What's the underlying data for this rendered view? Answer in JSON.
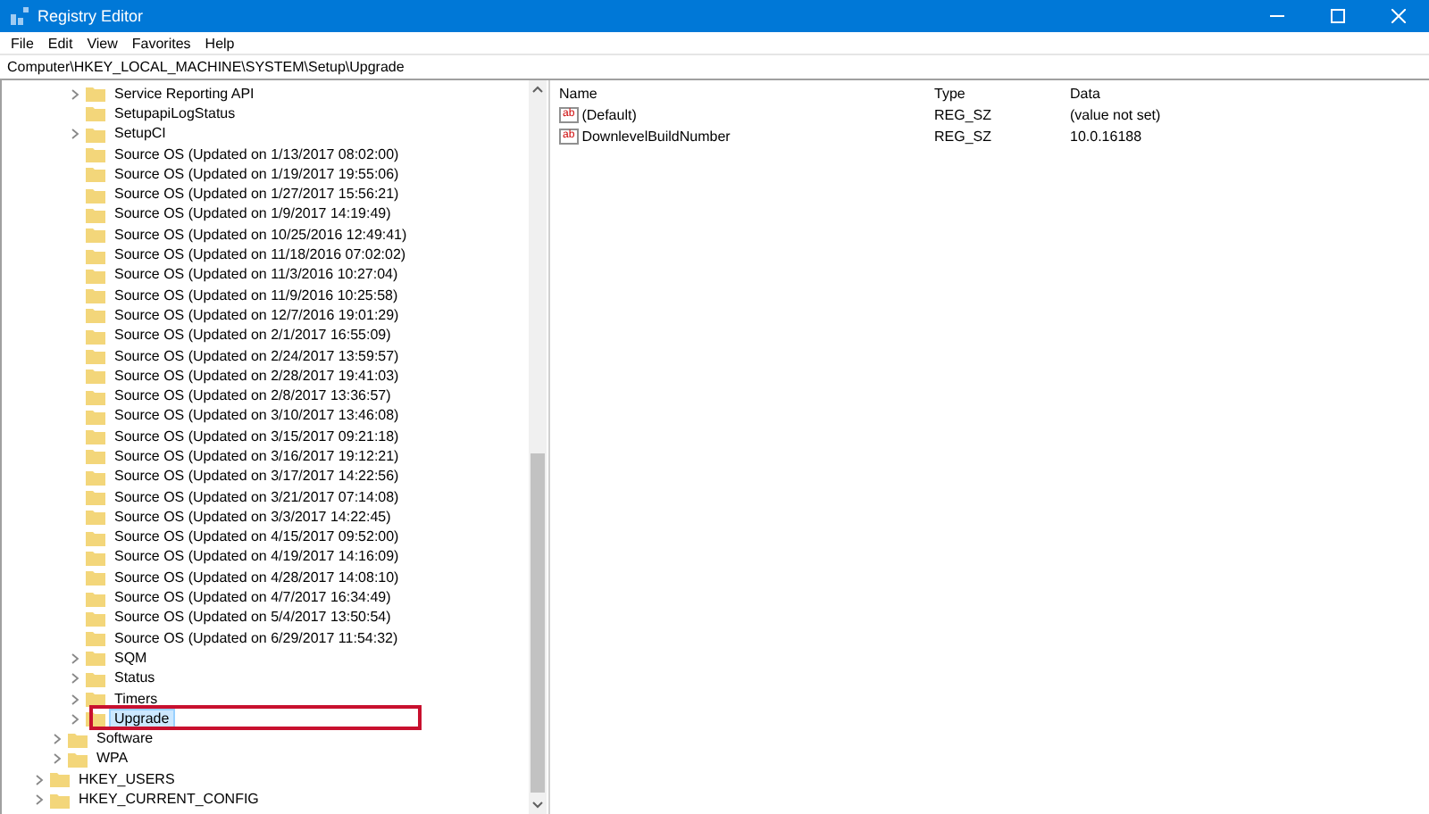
{
  "window": {
    "title": "Registry Editor"
  },
  "menu": [
    "File",
    "Edit",
    "View",
    "Favorites",
    "Help"
  ],
  "address": "Computer\\HKEY_LOCAL_MACHINE\\SYSTEM\\Setup\\Upgrade",
  "tree": {
    "items": [
      {
        "children": [
          {
            "children": [
              {
                "label": "Service Reporting API",
                "expandable": true,
                "selected": false,
                "outlined": false
              },
              {
                "label": "SetupapiLogStatus",
                "expandable": false,
                "selected": false,
                "outlined": false
              },
              {
                "label": "SetupCI",
                "expandable": true,
                "selected": false,
                "outlined": false
              },
              {
                "label": "Source OS (Updated on 1/13/2017 08:02:00)",
                "expandable": false,
                "selected": false,
                "outlined": false
              },
              {
                "label": "Source OS (Updated on 1/19/2017 19:55:06)",
                "expandable": false,
                "selected": false,
                "outlined": false
              },
              {
                "label": "Source OS (Updated on 1/27/2017 15:56:21)",
                "expandable": false,
                "selected": false,
                "outlined": false
              },
              {
                "label": "Source OS (Updated on 1/9/2017 14:19:49)",
                "expandable": false,
                "selected": false,
                "outlined": false
              },
              {
                "label": "Source OS (Updated on 10/25/2016 12:49:41)",
                "expandable": false,
                "selected": false,
                "outlined": false
              },
              {
                "label": "Source OS (Updated on 11/18/2016 07:02:02)",
                "expandable": false,
                "selected": false,
                "outlined": false
              },
              {
                "label": "Source OS (Updated on 11/3/2016 10:27:04)",
                "expandable": false,
                "selected": false,
                "outlined": false
              },
              {
                "label": "Source OS (Updated on 11/9/2016 10:25:58)",
                "expandable": false,
                "selected": false,
                "outlined": false
              },
              {
                "label": "Source OS (Updated on 12/7/2016 19:01:29)",
                "expandable": false,
                "selected": false,
                "outlined": false
              },
              {
                "label": "Source OS (Updated on 2/1/2017 16:55:09)",
                "expandable": false,
                "selected": false,
                "outlined": false
              },
              {
                "label": "Source OS (Updated on 2/24/2017 13:59:57)",
                "expandable": false,
                "selected": false,
                "outlined": false
              },
              {
                "label": "Source OS (Updated on 2/28/2017 19:41:03)",
                "expandable": false,
                "selected": false,
                "outlined": false
              },
              {
                "label": "Source OS (Updated on 2/8/2017 13:36:57)",
                "expandable": false,
                "selected": false,
                "outlined": false
              },
              {
                "label": "Source OS (Updated on 3/10/2017 13:46:08)",
                "expandable": false,
                "selected": false,
                "outlined": false
              },
              {
                "label": "Source OS (Updated on 3/15/2017 09:21:18)",
                "expandable": false,
                "selected": false,
                "outlined": false
              },
              {
                "label": "Source OS (Updated on 3/16/2017 19:12:21)",
                "expandable": false,
                "selected": false,
                "outlined": false
              },
              {
                "label": "Source OS (Updated on 3/17/2017 14:22:56)",
                "expandable": false,
                "selected": false,
                "outlined": false
              },
              {
                "label": "Source OS (Updated on 3/21/2017 07:14:08)",
                "expandable": false,
                "selected": false,
                "outlined": false
              },
              {
                "label": "Source OS (Updated on 3/3/2017 14:22:45)",
                "expandable": false,
                "selected": false,
                "outlined": false
              },
              {
                "label": "Source OS (Updated on 4/15/2017 09:52:00)",
                "expandable": false,
                "selected": false,
                "outlined": false
              },
              {
                "label": "Source OS (Updated on 4/19/2017 14:16:09)",
                "expandable": false,
                "selected": false,
                "outlined": false
              },
              {
                "label": "Source OS (Updated on 4/28/2017 14:08:10)",
                "expandable": false,
                "selected": false,
                "outlined": false
              },
              {
                "label": "Source OS (Updated on 4/7/2017 16:34:49)",
                "expandable": false,
                "selected": false,
                "outlined": false
              },
              {
                "label": "Source OS (Updated on 5/4/2017 13:50:54)",
                "expandable": false,
                "selected": false,
                "outlined": false
              },
              {
                "label": "Source OS (Updated on 6/29/2017 11:54:32)",
                "expandable": false,
                "selected": false,
                "outlined": false
              },
              {
                "label": "SQM",
                "expandable": true,
                "selected": false,
                "outlined": false
              },
              {
                "label": "Status",
                "expandable": true,
                "selected": false,
                "outlined": false
              },
              {
                "label": "Timers",
                "expandable": true,
                "selected": false,
                "outlined": false
              },
              {
                "label": "Upgrade",
                "expandable": true,
                "selected": true,
                "outlined": true
              }
            ]
          },
          {
            "label": "Software",
            "expandable": true,
            "selected": false,
            "outlined": false
          },
          {
            "label": "WPA",
            "expandable": true,
            "selected": false,
            "outlined": false
          }
        ]
      },
      {
        "label": "HKEY_USERS",
        "expandable": true,
        "selected": false,
        "outlined": false
      },
      {
        "label": "HKEY_CURRENT_CONFIG",
        "expandable": true,
        "selected": false,
        "outlined": false
      }
    ]
  },
  "values": {
    "columns": [
      "Name",
      "Type",
      "Data"
    ],
    "rows": [
      {
        "icon_label": "ab",
        "name": "(Default)",
        "type": "REG_SZ",
        "data": "(value not set)"
      },
      {
        "icon_label": "ab",
        "name": "DownlevelBuildNumber",
        "type": "REG_SZ",
        "data": "10.0.16188"
      }
    ]
  }
}
